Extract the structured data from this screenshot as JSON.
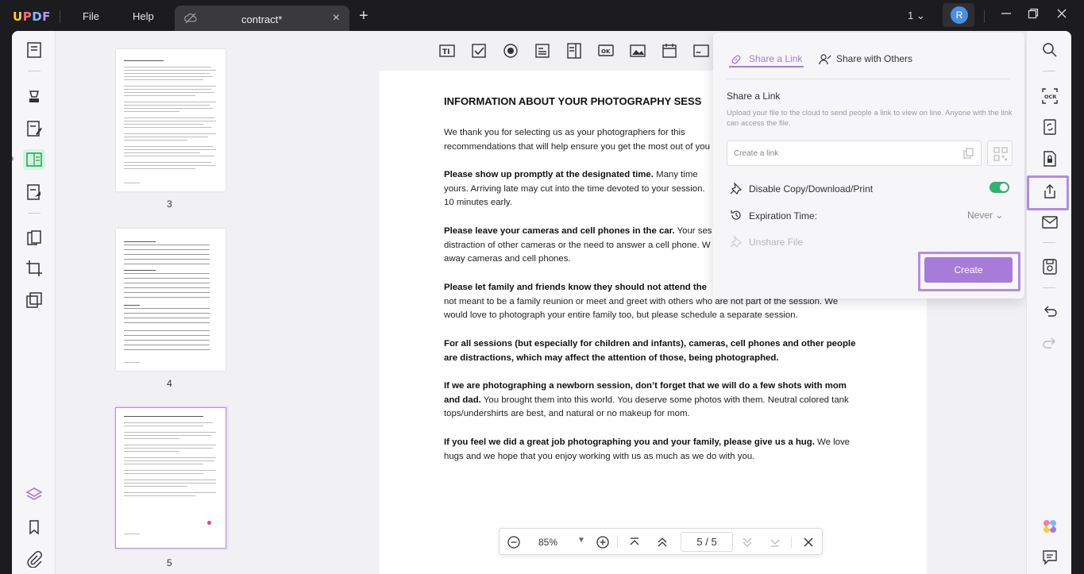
{
  "app": {
    "logo": "UPDF"
  },
  "menu": {
    "file": "File",
    "help": "Help"
  },
  "tab": {
    "title": "contract*"
  },
  "window": {
    "page_indicator": "1"
  },
  "user": {
    "initial": "R"
  },
  "thumbnails": [
    {
      "label": "3"
    },
    {
      "label": "4"
    },
    {
      "label": "5",
      "selected": true
    }
  ],
  "document": {
    "heading": "INFORMATION ABOUT YOUR PHOTOGRAPHY SESS",
    "paragraphs": [
      {
        "bold": "",
        "text": "We thank you for selecting us as your photographers for this",
        "text2": "recommendations that will help ensure you get the most out of you"
      },
      {
        "bold": "Please show up promptly at the designated time.",
        "text": " Many time",
        "text2": "yours. Arriving late may cut into the time devoted to your session.",
        "text3": "10 minutes early."
      },
      {
        "bold": "Please leave your cameras and cell phones in the car.",
        "text": " Your ses",
        "text2": "distraction of other cameras or the need to answer a cell phone. W",
        "text3": "away cameras and cell phones."
      },
      {
        "bold": "Please let family and friends know they should not attend the",
        "text": "",
        "text2": "not meant to be a family reunion or meet and greet with others who are not part of the session. We",
        "text3": "would love to photograph your entire family too, but please schedule a separate session."
      },
      {
        "bold": "For all sessions (but especially for children and infants), cameras, cell phones and other people",
        "bold2": "are distractions, which may affect the attention of those, being photographed."
      },
      {
        "bold": "If we are photographing a newborn session, don’t forget that we will do a few shots with mom",
        "bold2": "and dad.",
        "text": " You brought them into this world. You deserve some photos with them. Neutral colored tank",
        "text2": "tops/undershirts are best, and natural or no makeup for mom."
      },
      {
        "bold": "If you feel we did a great job photographing you and your family, please give us a hug.",
        "text": " We love",
        "text2": "hugs and we hope that you enjoy working with us as much as we do with you."
      }
    ]
  },
  "share_popup": {
    "tab_link": "Share a Link",
    "tab_others": "Share with Others",
    "title": "Share a Link",
    "description": "Upload your file to the cloud to send people a link to view on line. Anyone with the link can access the file.",
    "link_placeholder": "Create a link",
    "disable_copy_label": "Disable Copy/Download/Print",
    "disable_copy_enabled": true,
    "expiration_label": "Expiration Time:",
    "expiration_value": "Never",
    "unshare_label": "Unshare File",
    "create_label": "Create"
  },
  "zoombar": {
    "zoom": "85%",
    "current_page": "5",
    "page_sep": "/",
    "total_pages": "5"
  },
  "colors": {
    "accent": "#a67bd9",
    "toggle_on": "#2fb46c",
    "active_tool": "#2fb46c"
  }
}
